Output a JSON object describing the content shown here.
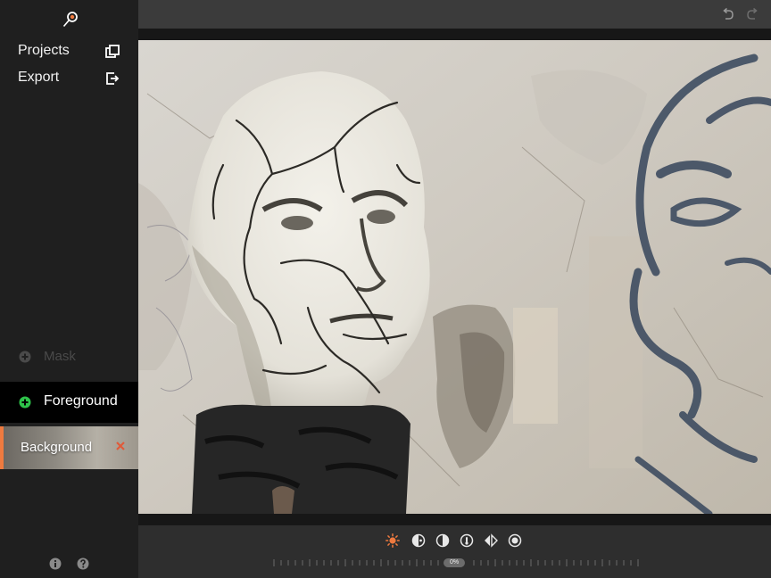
{
  "sidebar": {
    "menu": [
      {
        "label": "Projects",
        "icon": "projects-icon"
      },
      {
        "label": "Export",
        "icon": "export-icon"
      }
    ],
    "layers": {
      "mask": {
        "label": "Mask",
        "icon": "add-icon"
      },
      "foreground": {
        "label": "Foreground",
        "icon": "add-icon"
      },
      "background": {
        "label": "Background",
        "icon": "close-icon"
      }
    },
    "footer_icons": [
      "info-icon",
      "help-icon"
    ]
  },
  "topbar": {
    "icons": [
      "undo-icon",
      "redo-icon"
    ]
  },
  "bottombar": {
    "tools": [
      "brightness-icon",
      "contrast-icon",
      "exposure-icon",
      "temperature-icon",
      "flip-icon",
      "saturation-icon"
    ],
    "slider_value": "0%"
  },
  "colors": {
    "accent": "#ef7a3f",
    "add_active": "#2ec34a",
    "add_disabled": "#4a4a4a",
    "close": "#e05a3a"
  }
}
